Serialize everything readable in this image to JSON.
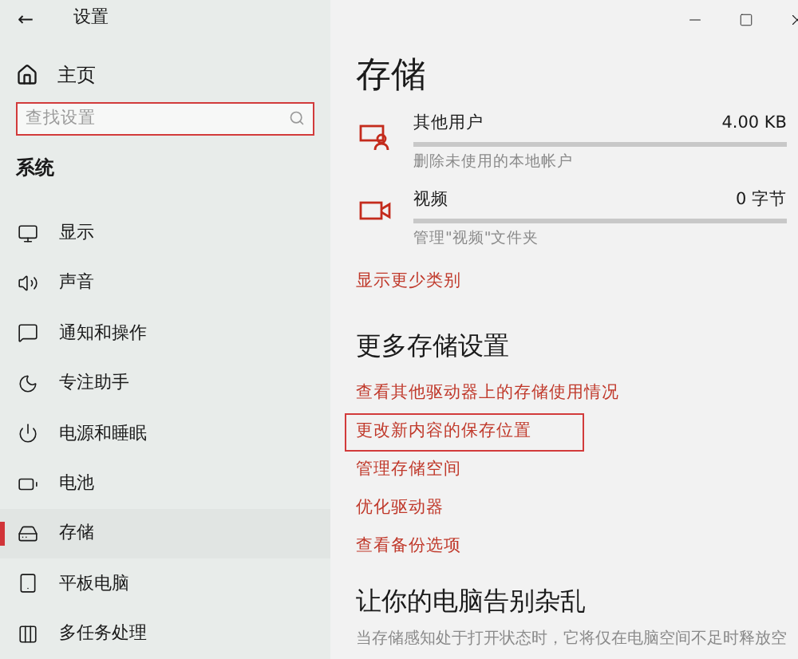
{
  "window": {
    "title": "设置",
    "back": "←"
  },
  "sidebar": {
    "home": "主页",
    "search": {
      "placeholder": "查找设置",
      "highlighted": true
    },
    "section": "系统",
    "items": [
      {
        "kind": "display",
        "label": "显示",
        "selected": false
      },
      {
        "kind": "sound",
        "label": "声音",
        "selected": false
      },
      {
        "kind": "notifications",
        "label": "通知和操作",
        "selected": false
      },
      {
        "kind": "focus",
        "label": "专注助手",
        "selected": false
      },
      {
        "kind": "power",
        "label": "电源和睡眠",
        "selected": false
      },
      {
        "kind": "battery",
        "label": "电池",
        "selected": false
      },
      {
        "kind": "storage",
        "label": "存储",
        "selected": true
      },
      {
        "kind": "tablet",
        "label": "平板电脑",
        "selected": false
      },
      {
        "kind": "multitask",
        "label": "多任务处理",
        "selected": false
      }
    ]
  },
  "main": {
    "title": "存储",
    "categories": [
      {
        "kind": "users",
        "name": "其他用户",
        "size": "4.00 KB",
        "description": "删除未使用的本地帐户"
      },
      {
        "kind": "videos",
        "name": "视频",
        "size": "0 字节",
        "description": "管理\"视频\"文件夹"
      }
    ],
    "show_less": "显示更少类别",
    "more_heading": "更多存储设置",
    "links": [
      {
        "label": "查看其他驱动器上的存储使用情况",
        "highlighted": false
      },
      {
        "label": "更改新内容的保存位置",
        "highlighted": true
      },
      {
        "label": "管理存储空间",
        "highlighted": false
      },
      {
        "label": "优化驱动器",
        "highlighted": false
      },
      {
        "label": "查看备份选项",
        "highlighted": false
      }
    ],
    "clutter_heading": "让你的电脑告别杂乱",
    "clutter_text": "当存储感知处于打开状态时，它将仅在电脑空间不足时释放空"
  }
}
